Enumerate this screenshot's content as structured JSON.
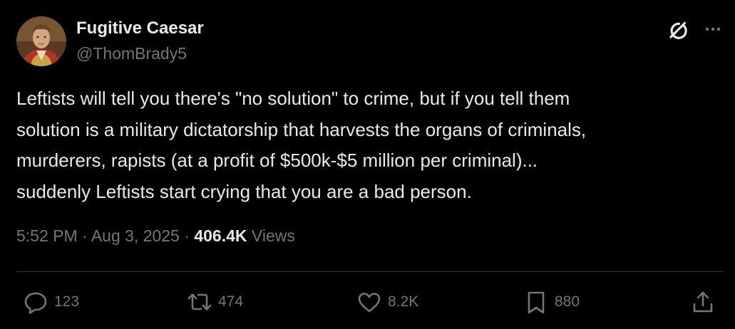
{
  "author": {
    "display_name": "Fugitive Caesar",
    "handle": "@ThomBrady5"
  },
  "tweet": {
    "text_lines": [
      "Leftists will tell you there's \"no solution\" to crime, but if you tell them",
      "solution is a military dictatorship that harvests the organs of criminals,",
      "murderers, rapists (at a profit of $500k-$5 million per criminal)...",
      "suddenly Leftists start crying that you are a bad person."
    ]
  },
  "meta": {
    "time": "5:52 PM",
    "separator1": " · ",
    "date": "Aug 3, 2025",
    "separator2": " · ",
    "views_count": "406.4K",
    "views_label": " Views"
  },
  "actions": {
    "replies": "123",
    "reposts": "474",
    "likes": "8.2K",
    "bookmarks": "880"
  },
  "icons": {
    "header": [
      "grok-icon",
      "more-icon"
    ],
    "actions": [
      "reply-icon",
      "repost-icon",
      "like-icon",
      "bookmark-icon",
      "share-icon"
    ]
  },
  "colors": {
    "background": "#000000",
    "text_primary": "#e7e9ea",
    "text_secondary": "#71767b",
    "divider": "#2f3336"
  }
}
